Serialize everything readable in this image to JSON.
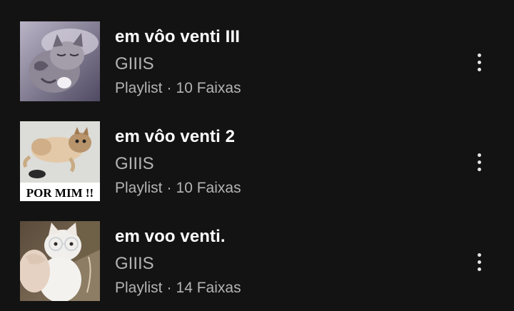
{
  "playlists": [
    {
      "title": "em vôo venti III",
      "owner": "GIIIS",
      "type": "Playlist",
      "separator": "·",
      "tracks": "10 Faixas",
      "thumbnail": "kitten-sleeping-image"
    },
    {
      "title": "em vôo venti 2",
      "owner": "GIIIS",
      "type": "Playlist",
      "separator": "·",
      "tracks": "10 Faixas",
      "thumbnail": "kittens-lying-image",
      "thumbnail_caption": "POR MIM !!"
    },
    {
      "title": "em voo venti.",
      "owner": "GIIIS",
      "type": "Playlist",
      "separator": "·",
      "tracks": "14 Faixas",
      "thumbnail": "cat-with-glasses-image"
    }
  ],
  "icons": {
    "more": "more-vertical-icon"
  },
  "colors": {
    "background": "#131313",
    "title": "#ffffff",
    "secondary": "#b4b4b4"
  }
}
